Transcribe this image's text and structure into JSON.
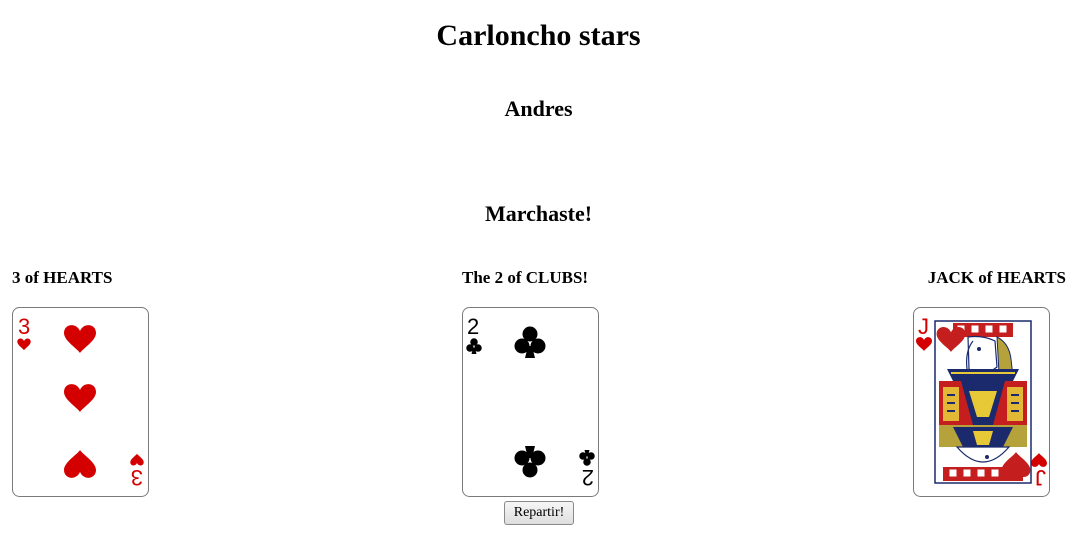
{
  "game": {
    "title": "Carloncho stars",
    "player_name": "Andres",
    "result_message": "Marchaste!"
  },
  "cards": {
    "left": {
      "caption": "3 of HEARTS",
      "rank": "3",
      "suit": "hearts",
      "suit_color": "#d40000"
    },
    "center": {
      "caption": "The 2 of CLUBS!",
      "rank": "2",
      "suit": "clubs",
      "suit_color": "#000000"
    },
    "right": {
      "caption": "JACK of HEARTS",
      "rank": "J",
      "suit": "hearts",
      "suit_color": "#d40000"
    }
  },
  "controls": {
    "deal_label": "Repartir!"
  }
}
